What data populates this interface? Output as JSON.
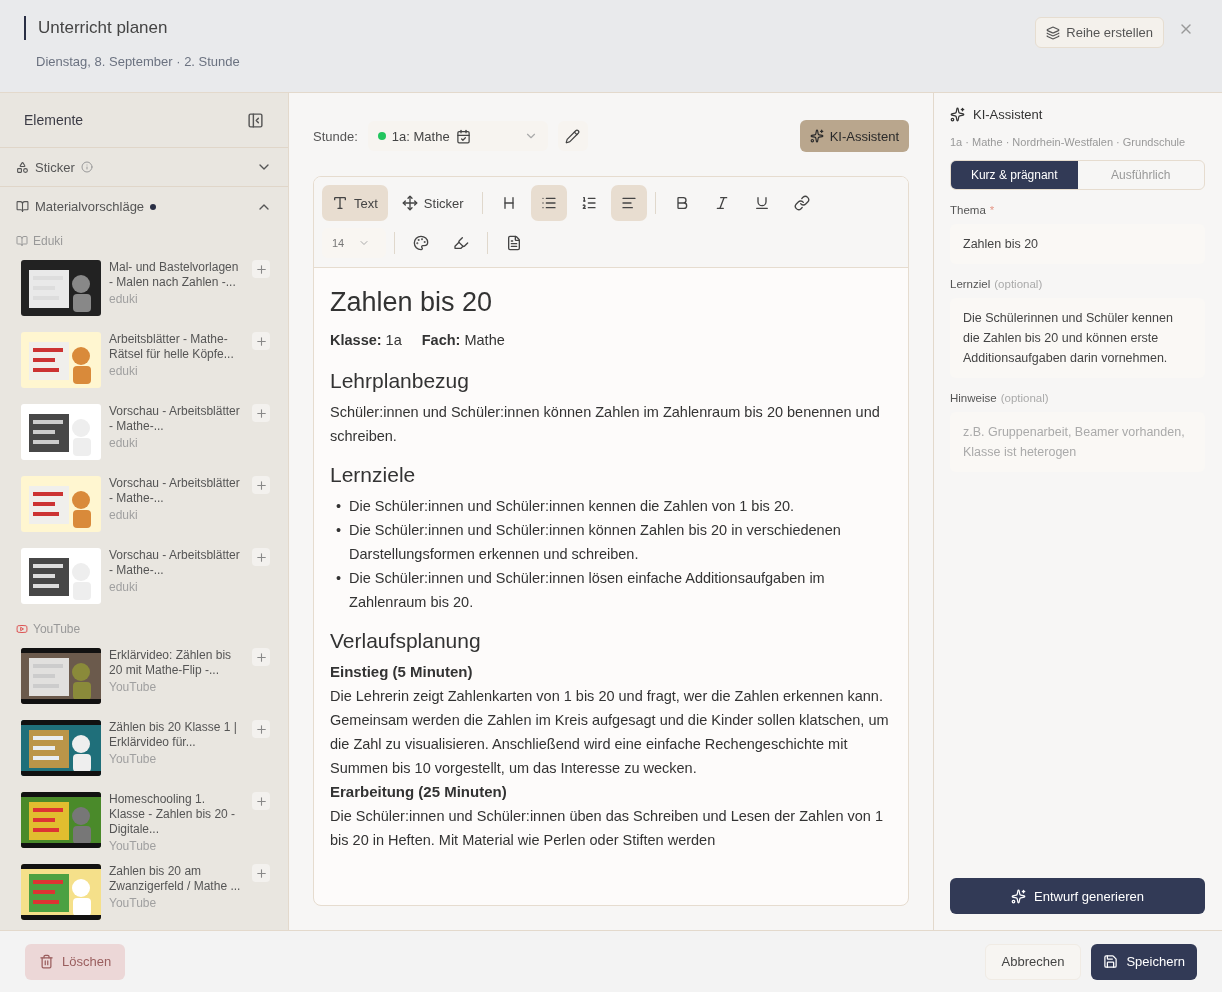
{
  "header": {
    "title": "Unterricht planen",
    "subtitle": "Dienstag, 8. September · 2. Stunde",
    "series_button": "Reihe erstellen"
  },
  "sidebar": {
    "title": "Elemente",
    "sticker_section": {
      "label": "Sticker",
      "expanded": false
    },
    "materials_section": {
      "label": "Materialvorschläge",
      "expanded": true,
      "groups": [
        {
          "kind": "eduki",
          "label": "Eduki",
          "items": [
            {
              "title": "Mal- und Bastelvorlagen - Malen nach Zahlen -...",
              "source": "eduki"
            },
            {
              "title": "Arbeitsblätter - Mathe-Rätsel für helle Köpfe...",
              "source": "eduki"
            },
            {
              "title": "Vorschau - Arbeitsblätter - Mathe-...",
              "source": "eduki"
            },
            {
              "title": "Vorschau - Arbeitsblätter - Mathe-...",
              "source": "eduki"
            },
            {
              "title": "Vorschau - Arbeitsblätter - Mathe-...",
              "source": "eduki"
            }
          ]
        },
        {
          "kind": "youtube",
          "label": "YouTube",
          "items": [
            {
              "title": "Erklärvideo: Zählen bis 20 mit Mathe-Flip -...",
              "source": "YouTube"
            },
            {
              "title": "Zählen bis 20 Klasse 1 | Erklärvideo für...",
              "source": "YouTube"
            },
            {
              "title": "Homeschooling 1. Klasse - Zahlen bis 20 - Digitale...",
              "source": "YouTube"
            },
            {
              "title": "Zahlen bis 20 am Zwanzigerfeld / Mathe ...",
              "source": "YouTube"
            }
          ]
        }
      ]
    }
  },
  "lesson": {
    "label": "Stunde:",
    "value": "1a: Mathe",
    "color": "#22c55e"
  },
  "ai_button": "KI-Assistent",
  "toolbar": {
    "modes": [
      {
        "kind": "text",
        "label": "Text",
        "selected": true
      },
      {
        "kind": "sticker",
        "label": "Sticker",
        "selected": false
      }
    ],
    "formats": [
      {
        "kind": "heading",
        "selected": false
      },
      {
        "kind": "bullets",
        "selected": true
      },
      {
        "kind": "numbers",
        "selected": false
      },
      {
        "kind": "align",
        "selected": true
      },
      {
        "kind": "bold",
        "selected": false
      },
      {
        "kind": "italic",
        "selected": false
      },
      {
        "kind": "underline",
        "selected": false
      },
      {
        "kind": "link",
        "selected": false
      }
    ],
    "font_size": "14"
  },
  "document": [
    {
      "kind": "title",
      "text": "Zahlen bis 20"
    },
    {
      "kind": "meta",
      "items": [
        "**Klasse:** 1a",
        "**Fach:** Mathe"
      ]
    },
    {
      "kind": "heading",
      "text": "Lehrplanbezug"
    },
    {
      "kind": "paragraph",
      "text": "Schüler:innen und Schüler:innen können Zahlen im Zahlenraum bis 20 benennen und schreiben."
    },
    {
      "kind": "heading",
      "text": "Lernziele"
    },
    {
      "kind": "list",
      "marker": "•",
      "items": [
        "Die Schüler:innen und Schüler:innen kennen die Zahlen von 1 bis 20.",
        "Die Schüler:innen und Schüler:innen können Zahlen bis 20 in verschiedenen Darstellungsformen erkennen und schreiben.",
        "Die Schüler:innen und Schüler:innen lösen einfache Additionsaufgaben im Zahlenraum bis 20."
      ]
    },
    {
      "kind": "heading",
      "text": "Verlaufsplanung"
    },
    {
      "kind": "subheading",
      "text": "Einstieg (5 Minuten)"
    },
    {
      "kind": "paragraph",
      "text": "Die Lehrerin zeigt Zahlenkarten von 1 bis 20 und fragt, wer die Zahlen erkennen kann. Gemeinsam werden die Zahlen im Kreis aufgesagt und die Kinder sollen klatschen, um die Zahl zu visualisieren. Anschließend wird eine einfache Rechengeschichte mit Summen bis 10 vorgestellt, um das Interesse zu wecken."
    },
    {
      "kind": "subheading",
      "text": "Erarbeitung (25 Minuten)"
    },
    {
      "kind": "paragraph",
      "text": "Die Schüler:innen und Schüler:innen üben das Schreiben und Lesen der Zahlen von 1 bis 20 in Heften. Mit Material wie Perlen oder Stiften werden"
    }
  ],
  "assistant": {
    "title": "KI-Assistent",
    "context": "1a · Mathe · Nordrhein-Westfalen · Grundschule",
    "modes": [
      {
        "label": "Kurz & prägnant",
        "selected": true
      },
      {
        "label": "Ausführlich",
        "selected": false
      }
    ],
    "fields": [
      {
        "label": "Thema",
        "required_mark": "*",
        "value": "Zahlen bis 20"
      },
      {
        "label": "Lernziel",
        "note": "(optional)",
        "value": "Die Schülerinnen und Schüler kennen die Zahlen bis 20 und können erste Additionsaufgaben darin vornehmen."
      },
      {
        "label": "Hinweise",
        "note": "(optional)",
        "placeholder": "z.B. Gruppenarbeit, Beamer vorhanden, Klasse ist heterogen"
      }
    ],
    "generate_button": "Entwurf generieren"
  },
  "footer": {
    "delete": {
      "label": "Löschen",
      "disabled": true
    },
    "cancel": "Abbrechen",
    "save": "Speichern"
  }
}
